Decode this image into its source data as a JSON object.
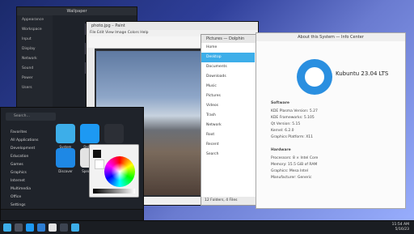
{
  "windows": {
    "system_settings": {
      "title": "Wallpaper",
      "sidebar_items": [
        "Appearance",
        "Workspace",
        "Input",
        "Display",
        "Network",
        "Sound",
        "Power",
        "Users"
      ]
    },
    "image_editor": {
      "title": "photo.jpg – Paint",
      "menu": "File  Edit  View  Image  Colors  Help",
      "status": "3200 × 2400  ·  100%"
    },
    "file_manager": {
      "title": "Pictures — Dolphin",
      "sidebar_items": [
        "Home",
        "Desktop",
        "Documents",
        "Downloads",
        "Music",
        "Pictures",
        "Videos",
        "Trash",
        "Network",
        "Root",
        "Recent",
        "Search"
      ],
      "selected_index": 1,
      "bottom_text": "12 Folders, 4 Files"
    },
    "about": {
      "title": "About this System — Info Center",
      "os_name": "Kubuntu 23.04 LTS",
      "section_1": "Software",
      "software_lines": [
        "KDE Plasma Version: 5.27",
        "KDE Frameworks: 5.105",
        "Qt Version: 5.15",
        "Kernel: 6.2.0",
        "Graphics Platform: X11"
      ],
      "section_2": "Hardware",
      "hardware_lines": [
        "Processors: 8 × Intel Core",
        "Memory: 15.5 GiB of RAM",
        "Graphics: Mesa Intel",
        "Manufacturer: Generic"
      ]
    },
    "launcher": {
      "search_placeholder": "Search…",
      "categories": [
        "Favorites",
        "All Applications",
        "Development",
        "Education",
        "Games",
        "Graphics",
        "Internet",
        "Multimedia",
        "Office",
        "Settings"
      ],
      "apps": [
        "System Settings",
        "Dolphin",
        "Konsole",
        "Discover",
        "Spectacle",
        "Kate"
      ]
    }
  },
  "taskbar": {
    "time": "11:54 AM",
    "date": "5/16/23"
  }
}
